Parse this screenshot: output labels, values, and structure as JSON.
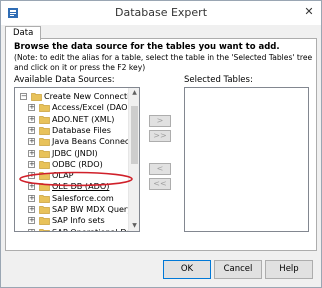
{
  "window": {
    "title": "Database Expert",
    "close_glyph": "✕"
  },
  "tabs": [
    {
      "label": "Data",
      "active": true
    }
  ],
  "main": {
    "heading": "Browse the data source for the tables you want to add.",
    "note": "(Note: to edit the alias for a table, select the table in the 'Selected Tables' tree and click on it or press the F2 key)",
    "available_label": "Available Data Sources:",
    "selected_label": "Selected Tables:"
  },
  "tree": {
    "items": [
      {
        "label": "Create New Connection",
        "level": 0,
        "expander": "−",
        "icon": "folder-open-icon"
      },
      {
        "label": "Access/Excel (DAO)",
        "level": 1,
        "expander": "+",
        "icon": "folder-icon"
      },
      {
        "label": "ADO.NET (XML)",
        "level": 1,
        "expander": "+",
        "icon": "folder-icon"
      },
      {
        "label": "Database Files",
        "level": 1,
        "expander": "+",
        "icon": "folder-icon"
      },
      {
        "label": "Java Beans Connectivit",
        "level": 1,
        "expander": "+",
        "icon": "folder-icon"
      },
      {
        "label": "JDBC (JNDI)",
        "level": 1,
        "expander": "+",
        "icon": "folder-icon"
      },
      {
        "label": "ODBC (RDO)",
        "level": 1,
        "expander": "+",
        "icon": "folder-icon"
      },
      {
        "label": "OLAP",
        "level": 1,
        "expander": "+",
        "icon": "folder-icon"
      },
      {
        "label": "OLE DB (ADO)",
        "level": 1,
        "expander": "+",
        "icon": "folder-icon",
        "highlighted": true
      },
      {
        "label": "Salesforce.com",
        "level": 1,
        "expander": "+",
        "icon": "folder-icon"
      },
      {
        "label": "SAP BW MDX Query",
        "level": 1,
        "expander": "+",
        "icon": "folder-icon"
      },
      {
        "label": "SAP Info sets",
        "level": 1,
        "expander": "+",
        "icon": "folder-icon"
      },
      {
        "label": "SAP Operational Data S",
        "level": 1,
        "expander": "+",
        "icon": "folder-icon"
      },
      {
        "label": "SAP Table, Cluster",
        "level": 1,
        "expander": "+",
        "icon": "folder-icon"
      }
    ]
  },
  "move_buttons": [
    {
      "label": ">",
      "enabled": false
    },
    {
      "label": ">>",
      "enabled": false
    },
    {
      "label": "<",
      "enabled": false
    },
    {
      "label": "<<",
      "enabled": false
    }
  ],
  "footer": {
    "ok": "OK",
    "cancel": "Cancel",
    "help": "Help"
  },
  "colors": {
    "folder": "#e8c25a",
    "folder_dark": "#c9a13a",
    "annotation": "#d0202a",
    "default_button_border": "#0078d7"
  },
  "scroll": {
    "up_glyph": "▲",
    "down_glyph": "▼"
  }
}
